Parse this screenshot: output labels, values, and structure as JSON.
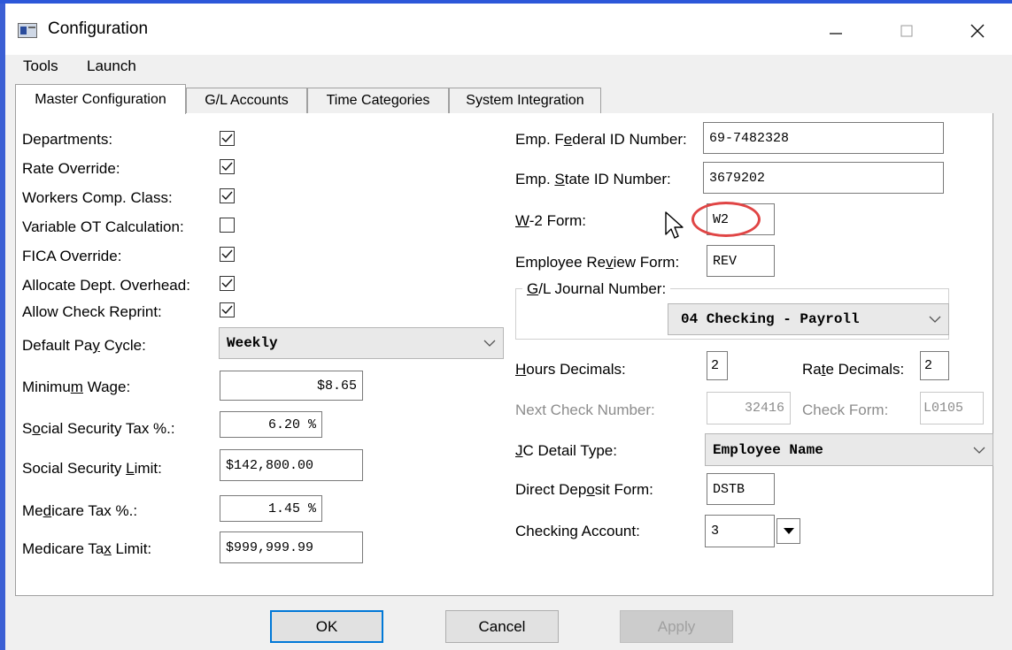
{
  "window": {
    "title": "Configuration"
  },
  "menu": [
    "Tools",
    "Launch"
  ],
  "tabs": [
    "Master Configuration",
    "G/L Accounts",
    "Time Categories",
    "System Integration"
  ],
  "left_checks": [
    {
      "label": "Departments:",
      "checked": true
    },
    {
      "label": "Rate Override:",
      "checked": true
    },
    {
      "label": "Workers Comp. Class:",
      "checked": true
    },
    {
      "label": "Variable OT Calculation:",
      "checked": false
    },
    {
      "label": "FICA Override:",
      "checked": true
    },
    {
      "label": "Allocate Dept. Overhead:",
      "checked": true
    },
    {
      "label": "Allow Check Reprint:",
      "checked": true
    }
  ],
  "pay_cycle": {
    "label_a": "Default Pa",
    "label_u": "y",
    "label_b": " Cycle:",
    "value": "Weekly"
  },
  "min_wage": {
    "label_a": "Minimu",
    "label_u": "m",
    "label_b": " Wage:",
    "value": "$8.65"
  },
  "ss_tax": {
    "label_a": "S",
    "label_u": "o",
    "label_b": "cial Security Tax %.:",
    "value": "6.20 %"
  },
  "ss_limit": {
    "label_a": "Social Security ",
    "label_u": "L",
    "label_b": "imit:",
    "value": "$142,800.00"
  },
  "med_tax": {
    "label_a": "Me",
    "label_u": "d",
    "label_b": "icare Tax %.:",
    "value": "1.45 %"
  },
  "med_limit": {
    "label_a": "Medicare Ta",
    "label_u": "x",
    "label_b": " Limit:",
    "value": "$999,999.99"
  },
  "fed_id": {
    "label_a": "Emp. F",
    "label_u": "e",
    "label_b": "deral ID Number:",
    "value": "69-7482328"
  },
  "state_id": {
    "label_a": "Emp. ",
    "label_u": "S",
    "label_b": "tate ID Number:",
    "value": "3679202"
  },
  "w2": {
    "label_a": "",
    "label_u": "W",
    "label_b": "-2 Form:",
    "value": "W2"
  },
  "review": {
    "label_a": "Employee Re",
    "label_u": "v",
    "label_b": "iew Form:",
    "value": "REV"
  },
  "gl_journal": {
    "label_a": "",
    "label_u": "G",
    "label_b": "/L Journal Number:",
    "value": "04 Checking - Payroll"
  },
  "hours_dec": {
    "label_a": "",
    "label_u": "H",
    "label_b": "ours Decimals:",
    "value": "2"
  },
  "rate_dec": {
    "label_a": "Ra",
    "label_u": "t",
    "label_b": "e Decimals:",
    "value": "2"
  },
  "next_check": {
    "label": "Next Check Number:",
    "value": "32416"
  },
  "check_form": {
    "label": "Check Form:",
    "value": "L0105"
  },
  "jc_detail": {
    "label_a": "",
    "label_u": "J",
    "label_b": "C Detail Type:",
    "value": "Employee Name"
  },
  "direct_deposit": {
    "label_a": "Direct Dep",
    "label_u": "o",
    "label_b": "sit Form:",
    "value": "DSTB"
  },
  "checking_acct": {
    "label": "Checking Account:",
    "value": "3"
  },
  "buttons": {
    "ok": "OK",
    "cancel": "Cancel",
    "apply": "Apply"
  }
}
